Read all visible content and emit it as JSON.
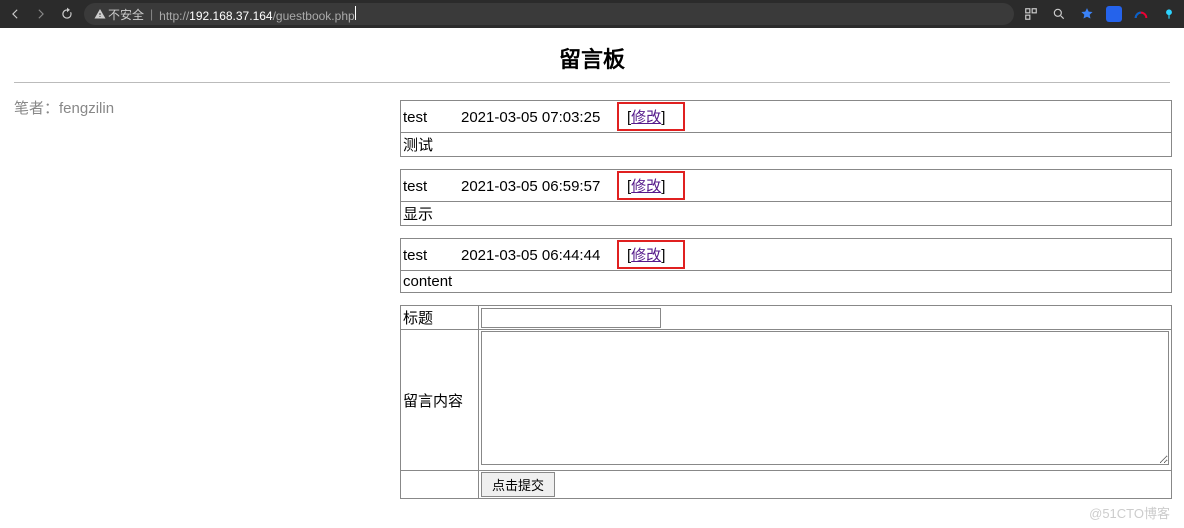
{
  "toolbar": {
    "insecure_label": "不安全",
    "url_scheme": "http://",
    "url_host": "192.168.37.164",
    "url_path": "/guestbook.php"
  },
  "page": {
    "title": "留言板",
    "author_label": "笔者：",
    "author_name": "fengzilin"
  },
  "entries": [
    {
      "user": "test",
      "date": "2021-03-05 07:03:25",
      "edit": "修改",
      "content": "测试"
    },
    {
      "user": "test",
      "date": "2021-03-05 06:59:57",
      "edit": "修改",
      "content": "显示"
    },
    {
      "user": "test",
      "date": "2021-03-05 06:44:44",
      "edit": "修改",
      "content": "content"
    }
  ],
  "form": {
    "title_label": "标题",
    "content_label": "留言内容",
    "submit_label": "点击提交"
  },
  "watermark": "@51CTO博客"
}
